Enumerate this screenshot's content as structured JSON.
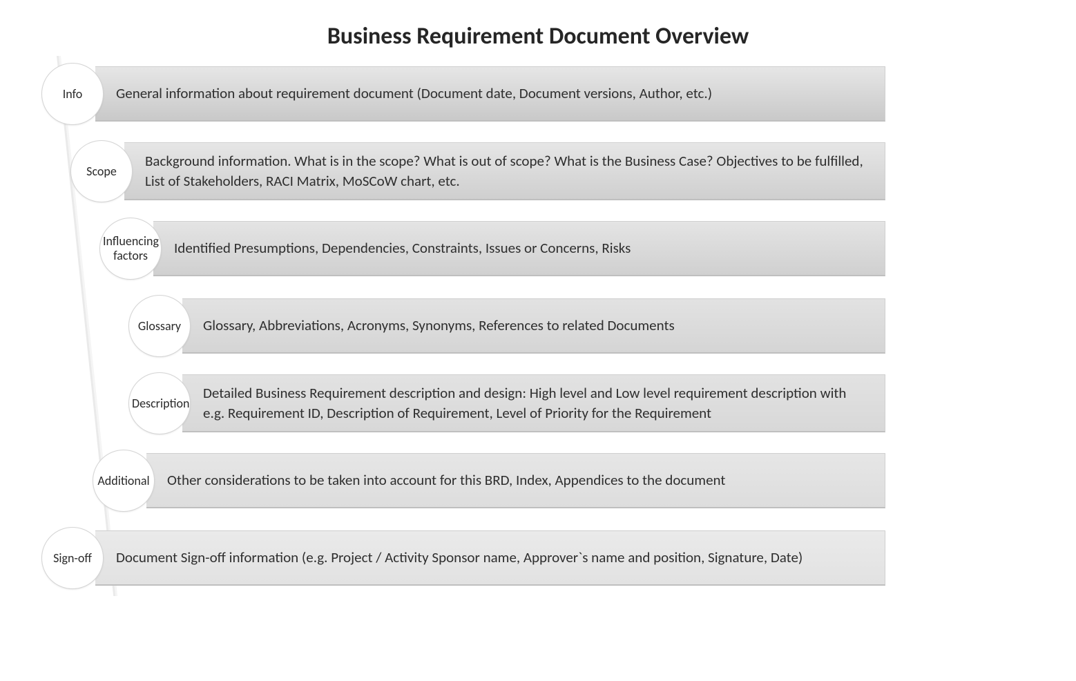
{
  "title": "Business Requirement Document Overview",
  "rows": [
    {
      "label": "Info",
      "text": "General information about requirement document (Document date, Document versions, Author, etc.)"
    },
    {
      "label": "Scope",
      "text": "Background information. What is in the scope? What is out of scope? What is the Business Case? Objectives to be fulfilled, List of Stakeholders, RACI Matrix, MoSCoW chart, etc."
    },
    {
      "label": "Influencing factors",
      "text": "Identified Presumptions, Dependencies, Constraints, Issues or Concerns, Risks"
    },
    {
      "label": "Glossary",
      "text": "Glossary, Abbreviations, Acronyms, Synonyms, References to related Documents"
    },
    {
      "label": "Description",
      "text": "Detailed Business Requirement description and design: High level and Low level requirement description with e.g. Requirement ID, Description of Requirement, Level of Priority for the Requirement"
    },
    {
      "label": "Additional",
      "text": "Other considerations to be taken into account for this BRD, Index, Appendices to the document"
    },
    {
      "label": "Sign-off",
      "text": "Document Sign-off information (e.g. Project / Activity Sponsor name, Approver`s name and position, Signature, Date)"
    }
  ]
}
